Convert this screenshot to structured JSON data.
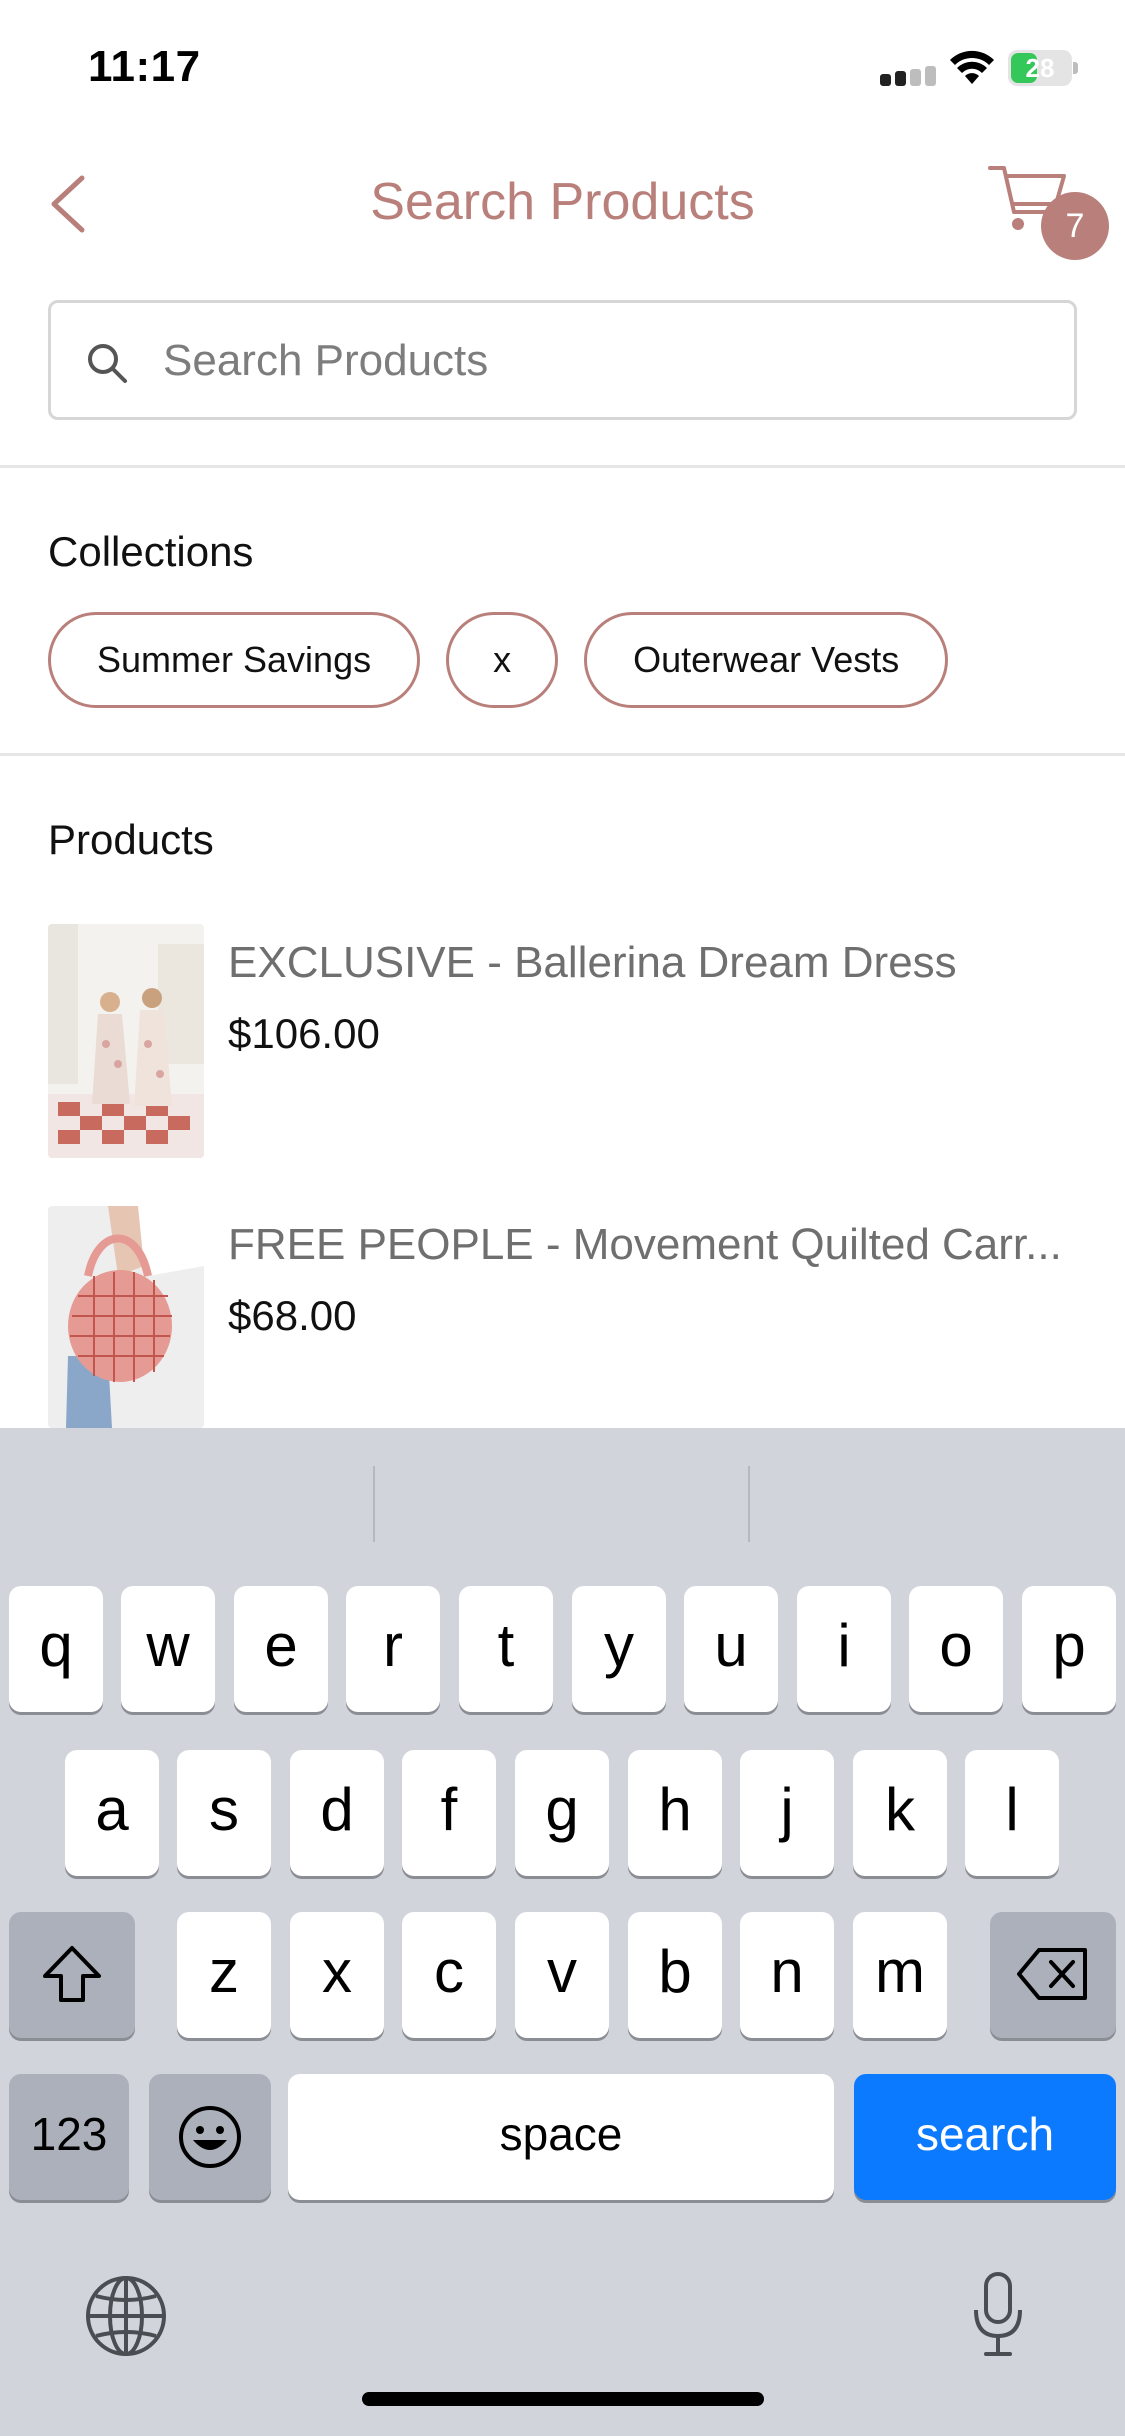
{
  "status_bar": {
    "time": "11:17",
    "battery": "28"
  },
  "header": {
    "title": "Search Products",
    "cart_count": "7",
    "accent_color": "#b9807b"
  },
  "search": {
    "placeholder": "Search Products",
    "value": ""
  },
  "collections": {
    "title": "Collections",
    "items": [
      "Summer Savings",
      "x",
      "Outerwear Vests"
    ]
  },
  "products": {
    "title": "Products",
    "items": [
      {
        "name": "EXCLUSIVE - Ballerina Dream Dress",
        "price": "$106.00"
      },
      {
        "name": "FREE PEOPLE - Movement Quilted Carr...",
        "price": "$68.00"
      }
    ]
  },
  "keyboard": {
    "row1": [
      "q",
      "w",
      "e",
      "r",
      "t",
      "y",
      "u",
      "i",
      "o",
      "p"
    ],
    "row2": [
      "a",
      "s",
      "d",
      "f",
      "g",
      "h",
      "j",
      "k",
      "l"
    ],
    "row3": [
      "z",
      "x",
      "c",
      "v",
      "b",
      "n",
      "m"
    ],
    "numbers_key": "123",
    "space_key": "space",
    "action_key": "search"
  }
}
